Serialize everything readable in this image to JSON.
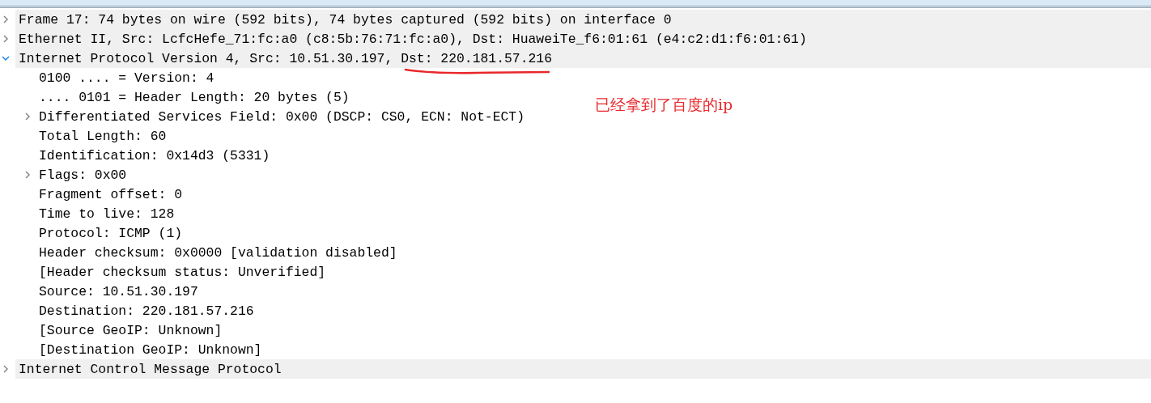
{
  "packet_details": [
    {
      "label": "Frame 17: 74 bytes on wire (592 bits), 74 bytes captured (592 bits) on interface 0",
      "expanded": false
    },
    {
      "label": "Ethernet II, Src: LcfcHefe_71:fc:a0 (c8:5b:76:71:fc:a0), Dst: HuaweiTe_f6:01:61 (e4:c2:d1:f6:01:61)",
      "expanded": false
    },
    {
      "label": "Internet Protocol Version 4, Src: 10.51.30.197, Dst: 220.181.57.216",
      "expanded": true,
      "children": [
        {
          "label": "0100 .... = Version: 4"
        },
        {
          "label": ".... 0101 = Header Length: 20 bytes (5)"
        },
        {
          "label": "Differentiated Services Field: 0x00 (DSCP: CS0, ECN: Not-ECT)",
          "expanded": false
        },
        {
          "label": "Total Length: 60"
        },
        {
          "label": "Identification: 0x14d3 (5331)"
        },
        {
          "label": "Flags: 0x00",
          "expanded": false
        },
        {
          "label": "Fragment offset: 0"
        },
        {
          "label": "Time to live: 128"
        },
        {
          "label": "Protocol: ICMP (1)"
        },
        {
          "label": "Header checksum: 0x0000 [validation disabled]"
        },
        {
          "label": "[Header checksum status: Unverified]"
        },
        {
          "label": "Source: 10.51.30.197"
        },
        {
          "label": "Destination: 220.181.57.216"
        },
        {
          "label": "[Source GeoIP: Unknown]"
        },
        {
          "label": "[Destination GeoIP: Unknown]"
        }
      ]
    },
    {
      "label": "Internet Control Message Protocol",
      "expanded": false
    }
  ],
  "annotation": {
    "text": "已经拿到了百度的ip"
  }
}
